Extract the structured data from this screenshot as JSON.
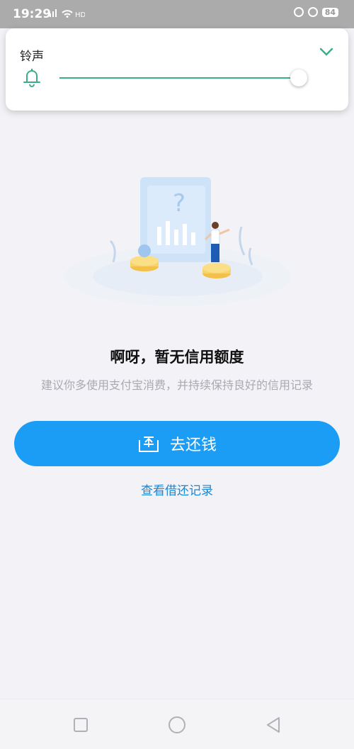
{
  "status_bar": {
    "time": "19:29",
    "signal_label": "ᵢ₄ᵢ",
    "battery": "84"
  },
  "volume_panel": {
    "title": "铃声",
    "level_fraction": 0.97,
    "accent_color": "#3aaf87",
    "icons": [
      "bell-icon",
      "chevron-down-icon"
    ]
  },
  "empty_state": {
    "title": "啊呀，暂无信用额度",
    "subtitle": "建议你多使用支付宝消费，并持续保持良好的信用记录",
    "illustration_text": "?"
  },
  "actions": {
    "repay_label": "去还钱",
    "repay_color": "#1b9cf5",
    "history_label": "查看借还记录",
    "history_color": "#1a86d6"
  },
  "nav": {
    "icons": [
      "recent-apps-icon",
      "home-icon",
      "back-icon"
    ]
  }
}
